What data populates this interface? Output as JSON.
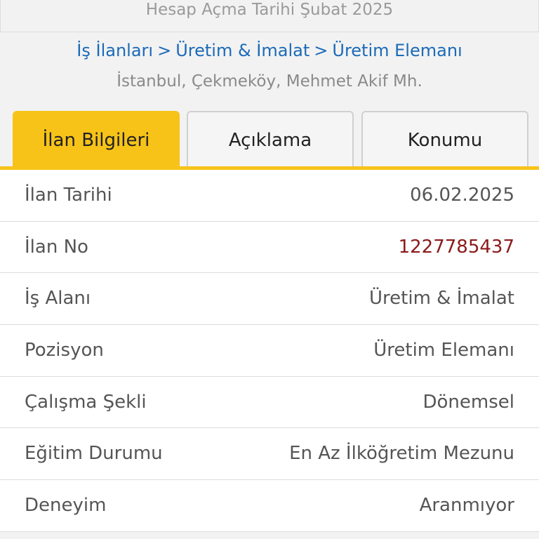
{
  "account": {
    "opened_text": "Hesap Açma Tarihi  Şubat 2025"
  },
  "breadcrumb": {
    "items": [
      "İş İlanları",
      "Üretim & İmalat",
      "Üretim Elemanı"
    ],
    "separator": ">"
  },
  "location": "İstanbul, Çekmeköy, Mehmet Akif Mh.",
  "tabs": [
    {
      "label": "İlan Bilgileri",
      "active": true
    },
    {
      "label": "Açıklama",
      "active": false
    },
    {
      "label": "Konumu",
      "active": false
    }
  ],
  "details": {
    "rows": [
      {
        "label": "İlan Tarihi",
        "value": "06.02.2025"
      },
      {
        "label": "İlan No",
        "value": "1227785437"
      },
      {
        "label": "İş Alanı",
        "value": "Üretim & İmalat"
      },
      {
        "label": "Pozisyon",
        "value": "Üretim Elemanı"
      },
      {
        "label": "Çalışma Şekli",
        "value": "Dönemsel"
      },
      {
        "label": "Eğitim Durumu",
        "value": "En Az İlköğretim Mezunu"
      },
      {
        "label": "Deneyim",
        "value": "Aranmıyor"
      }
    ]
  },
  "colors": {
    "accent": "#f7c318",
    "link": "#1b6ab8",
    "listing_no": "#8b1a1a"
  }
}
